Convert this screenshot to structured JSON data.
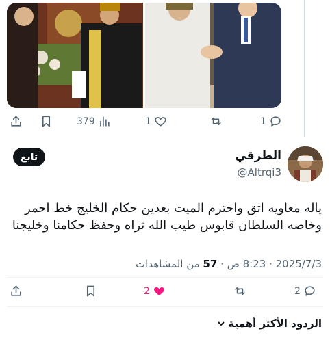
{
  "top_actions": {
    "views_count": "379",
    "likes_count": "1",
    "replies_count": "1"
  },
  "author": {
    "display_name": "الطرقي",
    "handle": "@Altrqi3",
    "follow_label": "تابع"
  },
  "tweet": {
    "line1": "ياله معاويه اتق واحترم الميت بعدين حكام الخليج خط احمر",
    "line2": "وخاصه السلطان قابوس طيب الله ثراه وحفظ حكامنا وخليجنا"
  },
  "meta": {
    "date": "2025/7/3",
    "separator": "·",
    "time": "8:23 ص",
    "views_count": "57",
    "views_label": "من المشاهدات"
  },
  "bottom_actions": {
    "likes_count": "2",
    "replies_count": "2"
  },
  "replies_sort": {
    "label": "الردود الأكثر أهمية"
  },
  "colors": {
    "accent_like": "#f91880",
    "muted": "#536471",
    "text": "#0f1419"
  },
  "icons": [
    "share-icon",
    "bookmark-icon",
    "views-icon",
    "heart-icon",
    "retweet-icon",
    "reply-icon",
    "chevron-down-icon"
  ]
}
